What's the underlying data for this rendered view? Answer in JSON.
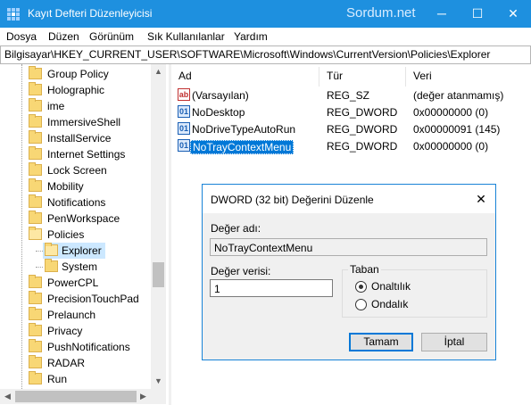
{
  "titlebar": {
    "title": "Kayıt Defteri Düzenleyicisi",
    "watermark": "Sordum.net",
    "minimize": "─",
    "maximize": "☐",
    "close": "✕"
  },
  "menu": {
    "items": [
      "Dosya",
      "Düzen",
      "Görünüm",
      "Sık Kullanılanlar",
      "Yardım"
    ]
  },
  "address": {
    "path": "Bilgisayar\\HKEY_CURRENT_USER\\SOFTWARE\\Microsoft\\Windows\\CurrentVersion\\Policies\\Explorer"
  },
  "tree": {
    "items": [
      {
        "label": "Group Policy"
      },
      {
        "label": "Holographic"
      },
      {
        "label": "ime"
      },
      {
        "label": "ImmersiveShell"
      },
      {
        "label": "InstallService"
      },
      {
        "label": "Internet Settings"
      },
      {
        "label": "Lock Screen"
      },
      {
        "label": "Mobility"
      },
      {
        "label": "Notifications"
      },
      {
        "label": "PenWorkspace"
      },
      {
        "label": "Policies"
      },
      {
        "label": "Explorer"
      },
      {
        "label": "System"
      },
      {
        "label": "PowerCPL"
      },
      {
        "label": "PrecisionTouchPad"
      },
      {
        "label": "Prelaunch"
      },
      {
        "label": "Privacy"
      },
      {
        "label": "PushNotifications"
      },
      {
        "label": "RADAR"
      },
      {
        "label": "Run"
      }
    ]
  },
  "list": {
    "headers": {
      "name": "Ad",
      "type": "Tür",
      "data": "Veri"
    },
    "rows": [
      {
        "name": "(Varsayılan)",
        "type": "REG_SZ",
        "data": "(değer atanmamış)",
        "icon": "string-value-icon"
      },
      {
        "name": "NoDesktop",
        "type": "REG_DWORD",
        "data": "0x00000000 (0)",
        "icon": "dword-value-icon"
      },
      {
        "name": "NoDriveTypeAutoRun",
        "type": "REG_DWORD",
        "data": "0x00000091 (145)",
        "icon": "dword-value-icon"
      },
      {
        "name": "NoTrayContextMenu",
        "type": "REG_DWORD",
        "data": "0x00000000 (0)",
        "icon": "dword-value-icon"
      }
    ]
  },
  "dialog": {
    "title": "DWORD (32 bit) Değerini Düzenle",
    "close": "✕",
    "value_name_label": "Değer adı:",
    "value_name": "NoTrayContextMenu",
    "value_data_label": "Değer verisi:",
    "value_data": "1",
    "base_label": "Taban",
    "hex_label": "Onaltılık",
    "dec_label": "Ondalık",
    "ok": "Tamam",
    "cancel": "İptal",
    "selected_base": "hex"
  }
}
